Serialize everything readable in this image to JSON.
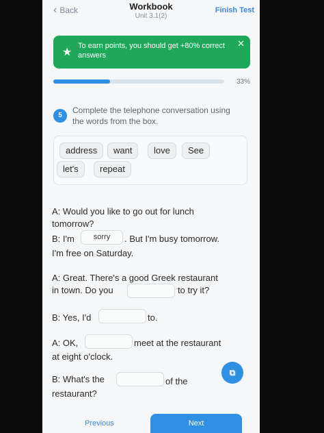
{
  "header": {
    "back_label": "Back",
    "title": "Workbook",
    "subtitle": "Unit 3.1(2)",
    "finish_label": "Finish Test"
  },
  "banner": {
    "text": "To earn points, you should get +80% correct answers",
    "close_icon": "close-icon",
    "star_icon": "star-icon"
  },
  "progress": {
    "percent_label": "33%",
    "fraction": 0.33
  },
  "question": {
    "number": "5",
    "instruction": "Complete the telephone conversation using the words from the box."
  },
  "word_box": {
    "words": [
      "address",
      "want",
      "love",
      "See",
      "let's",
      "repeat"
    ]
  },
  "dialogue": {
    "l1": "A: Would you like to go out for lunch",
    "l2": "tomorrow?",
    "l3a": "B: I'm",
    "l3_blank": "sorry",
    "l3b": ". But I'm busy tomorrow.",
    "l4": "I'm free on Saturday.",
    "l5": "A: Great. There's a good Greek restaurant",
    "l6a": "in town. Do you",
    "l6b": "to try it?",
    "l7a": "B: Yes, I'd",
    "l7b": "to.",
    "l8a": "A: OK,",
    "l8b": "meet at the restaurant",
    "l9": "at eight o'clock.",
    "l10a": "B: What's the",
    "l10b": "of the",
    "l11": "restaurant?"
  },
  "footer": {
    "previous_label": "Previous",
    "next_label": "Next"
  },
  "colors": {
    "accent": "#2f8fe0",
    "banner_green": "#1fa75a"
  }
}
